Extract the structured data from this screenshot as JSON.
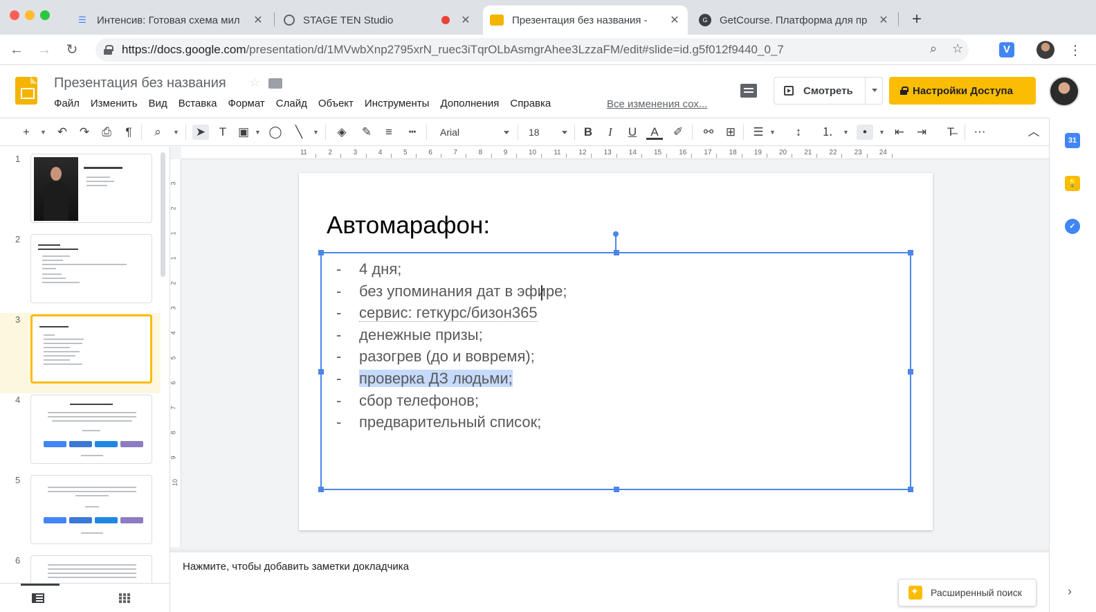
{
  "browser": {
    "tabs": [
      {
        "title": "Интенсив: Готовая схема мил",
        "active": false
      },
      {
        "title": "STAGE TEN Studio",
        "active": false
      },
      {
        "title": "Презентация без названия -",
        "active": true
      },
      {
        "title": "GetCourse. Платформа для пр",
        "active": false
      }
    ],
    "url_host": "https://docs.google.com",
    "url_path": "/presentation/d/1MVwbXnp2795xrN_ruec3iTqrOLbAsmgrAhee3LzzaFM/edit#slide=id.g5f012f9440_0_7",
    "extension_letter": "V"
  },
  "app": {
    "doc_title": "Презентация без названия",
    "menu": [
      "Файл",
      "Изменить",
      "Вид",
      "Вставка",
      "Формат",
      "Слайд",
      "Объект",
      "Инструменты",
      "Дополнения",
      "Справка"
    ],
    "save_status": "Все изменения сох...",
    "present_label": "Смотреть",
    "share_label": "Настройки Доступа"
  },
  "toolbar": {
    "font": "Arial",
    "size": "18"
  },
  "ruler": {
    "h_ticks": [
      "1",
      "1",
      "2",
      "3",
      "4",
      "5",
      "6",
      "7",
      "8",
      "9",
      "10",
      "11",
      "12",
      "13",
      "14",
      "15",
      "16",
      "17",
      "18",
      "19",
      "20",
      "21",
      "22",
      "23",
      "24"
    ],
    "v_ticks": [
      "3",
      "2",
      "1",
      "1",
      "2",
      "3",
      "4",
      "5",
      "6",
      "7",
      "8",
      "9",
      "10"
    ]
  },
  "filmstrip": {
    "slide_numbers": [
      "1",
      "2",
      "3",
      "4",
      "5",
      "6"
    ],
    "selected": 3
  },
  "slide": {
    "title": "Автомарафон:",
    "bullets": [
      "4 дня;",
      "без упоминания дат в эфире;",
      "сервис: геткурс/бизон365",
      "денежные призы;",
      "разогрев (до и вовремя);",
      "проверка ДЗ людьми;",
      "сбор телефонов;",
      "предварительный список;"
    ],
    "highlighted_index": 5
  },
  "notes": {
    "placeholder": "Нажмите, чтобы добавить заметки докладчика"
  },
  "explore": {
    "label": "Расширенный поиск"
  },
  "colors": {
    "share_button": "#fbbc04",
    "selection_border": "#4a86e8",
    "text_highlight": "#c6dafc",
    "thumb_selected": "#fbbc04"
  }
}
